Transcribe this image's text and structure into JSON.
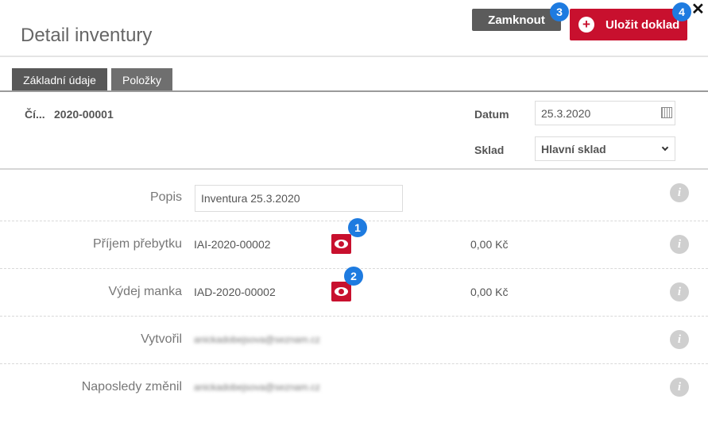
{
  "header": {
    "title": "Detail inventury",
    "lock_label": "Zamknout",
    "save_label": "Uložit doklad",
    "close_glyph": "✕"
  },
  "badges": [
    "1",
    "2",
    "3",
    "4"
  ],
  "tabs": [
    {
      "label": "Základní údaje",
      "active": true
    },
    {
      "label": "Položky",
      "active": false
    }
  ],
  "document": {
    "number_label": "Čí...",
    "number_value": "2020-00001",
    "date_label": "Datum",
    "date_value": "25.3.2020",
    "warehouse_label": "Sklad",
    "warehouse_value": "Hlavní sklad"
  },
  "rows": [
    {
      "label": "Popis",
      "value": "Inventura 25.3.2020"
    },
    {
      "label": "Příjem přebytku",
      "value": "IAI-2020-00002",
      "amount": "0,00 Kč"
    },
    {
      "label": "Výdej manka",
      "value": "IAD-2020-00002",
      "amount": "0,00 Kč"
    },
    {
      "label": "Vytvořil",
      "value": "anickadobejsova@seznam.cz"
    },
    {
      "label": "Naposledy změnil",
      "value": "anickadobejsova@seznam.cz"
    }
  ],
  "info_glyph": "i",
  "colors": {
    "accent_red": "#c8102e",
    "badge_blue": "#1e7be0",
    "tab_gray": "#585858"
  },
  "icons": [
    "calendar-icon",
    "chevron-down-icon",
    "eye-icon",
    "info-icon",
    "plus-icon",
    "close-icon"
  ]
}
